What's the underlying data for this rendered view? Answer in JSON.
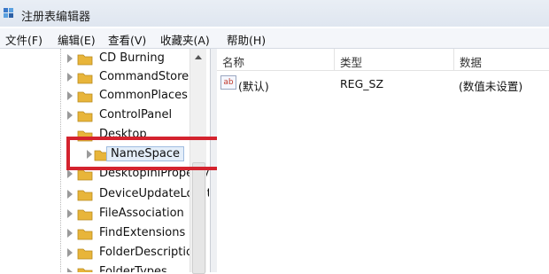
{
  "window": {
    "title": "注册表编辑器",
    "app_icon": "regedit-icon"
  },
  "menu": [
    "文件(F)",
    "编辑(E)",
    "查看(V)",
    "收藏夹(A)",
    "帮助(H)"
  ],
  "tree": {
    "items": [
      {
        "label": "CD Burning"
      },
      {
        "label": "CommandStore"
      },
      {
        "label": "CommonPlaces"
      },
      {
        "label": "ControlPanel"
      },
      {
        "label": "Desktop"
      },
      {
        "label": "NameSpace",
        "selected": true
      },
      {
        "label": "DesktopIniPropertyMap"
      },
      {
        "label": "DeviceUpdateLocations"
      },
      {
        "label": "FileAssociation"
      },
      {
        "label": "FindExtensions"
      },
      {
        "label": "FolderDescriptions"
      },
      {
        "label": "FolderTypes"
      }
    ]
  },
  "list": {
    "columns": [
      "名称",
      "类型",
      "数据"
    ],
    "rows": [
      {
        "icon": "ab",
        "name": "(默认)",
        "type": "REG_SZ",
        "data": "(数值未设置)"
      }
    ]
  },
  "colors": {
    "highlight_border": "#d4232e",
    "folder": "#e8b53a",
    "selection": "#e4eef9"
  }
}
